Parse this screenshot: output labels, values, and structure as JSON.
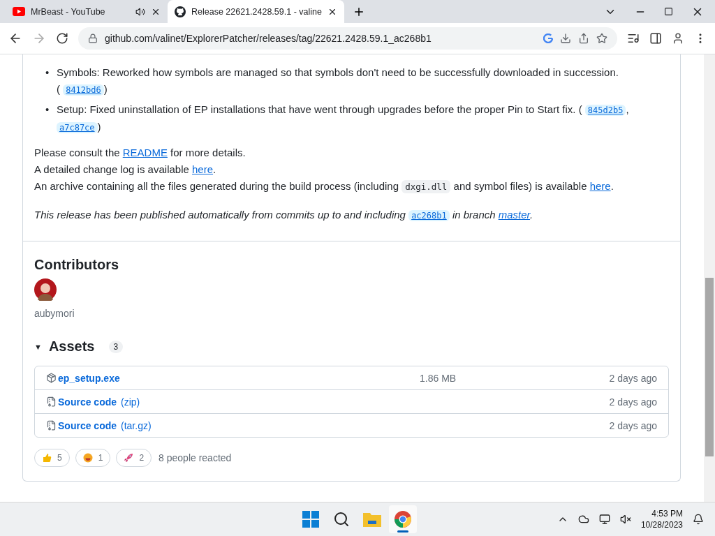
{
  "browser": {
    "tabs": [
      {
        "title": "MrBeast - YouTube",
        "kind": "youtube",
        "audio": true,
        "selected": false
      },
      {
        "title": "Release 22621.2428.59.1 - valine",
        "kind": "github",
        "audio": false,
        "selected": true
      }
    ],
    "url": "github.com/valinet/ExplorerPatcher/releases/tag/22621.2428.59.1_ac268b1"
  },
  "notes": {
    "marker": "•",
    "bullets": [
      [
        {
          "kind": "text",
          "text": "Symbols: Reworked how symbols are managed so that symbols don't need to be successfully downloaded in succession."
        },
        {
          "kind": "br"
        },
        {
          "kind": "text",
          "text": "("
        },
        {
          "kind": "commit",
          "text": "8412bd6"
        },
        {
          "kind": "text",
          "text": ")"
        }
      ],
      [
        {
          "kind": "text",
          "text": "Setup: Fixed uninstallation of EP installations that have went through upgrades before the proper Pin to Start fix. ("
        },
        {
          "kind": "commit",
          "text": "845d2b5"
        },
        {
          "kind": "text",
          "text": ","
        },
        {
          "kind": "br"
        },
        {
          "kind": "commit",
          "text": "a7c87ce"
        },
        {
          "kind": "text",
          "text": ")"
        }
      ]
    ],
    "lines": [
      [
        {
          "kind": "text",
          "text": "Please consult the"
        },
        {
          "kind": "link",
          "text": "README"
        },
        {
          "kind": "text",
          "text": "for more details."
        }
      ],
      [
        {
          "kind": "text",
          "text": "A detailed change log is available"
        },
        {
          "kind": "link",
          "text": "here"
        },
        {
          "kind": "text",
          "text": "."
        }
      ],
      [
        {
          "kind": "text",
          "text": "An archive containing all the files generated during the build process (including"
        },
        {
          "kind": "code",
          "text": "dxgi.dll"
        },
        {
          "kind": "text",
          "text": "and symbol files) is available"
        },
        {
          "kind": "link",
          "text": "here"
        },
        {
          "kind": "text",
          "text": "."
        }
      ]
    ],
    "footer": [
      {
        "kind": "text",
        "text": "This release has been published automatically from commits up to and including"
      },
      {
        "kind": "commit",
        "text": "ac268b1"
      },
      {
        "kind": "text",
        "text": "in branch"
      },
      {
        "kind": "link",
        "text": "master"
      },
      {
        "kind": "text",
        "text": "."
      }
    ]
  },
  "contributors": {
    "title": "Contributors",
    "users": [
      {
        "name": "aubymori"
      }
    ]
  },
  "assets": {
    "caret": "▼",
    "title": "Assets",
    "count": "3",
    "expanded": true,
    "files": [
      {
        "kind": "package",
        "name": "ep_setup.exe",
        "size": "1.86 MB",
        "date": "2 days ago"
      },
      {
        "kind": "archive",
        "name": "Source code",
        "suffix": "(zip)",
        "date": "2 days ago"
      },
      {
        "kind": "archive",
        "name": "Source code",
        "suffix": "(tar.gz)",
        "date": "2 days ago"
      }
    ]
  },
  "reactions": {
    "items": [
      {
        "kind": "thumbs",
        "count": "5"
      },
      {
        "kind": "laugh",
        "count": "1"
      },
      {
        "kind": "rocket",
        "count": "2"
      }
    ],
    "summary": "8 people reacted"
  },
  "taskbar": {
    "time": "4:53 PM",
    "date": "10/28/2023",
    "apps": [
      {
        "kind": "start",
        "active": false
      },
      {
        "kind": "search",
        "active": false
      },
      {
        "kind": "files",
        "active": false
      },
      {
        "kind": "chrome",
        "active": true
      }
    ]
  }
}
